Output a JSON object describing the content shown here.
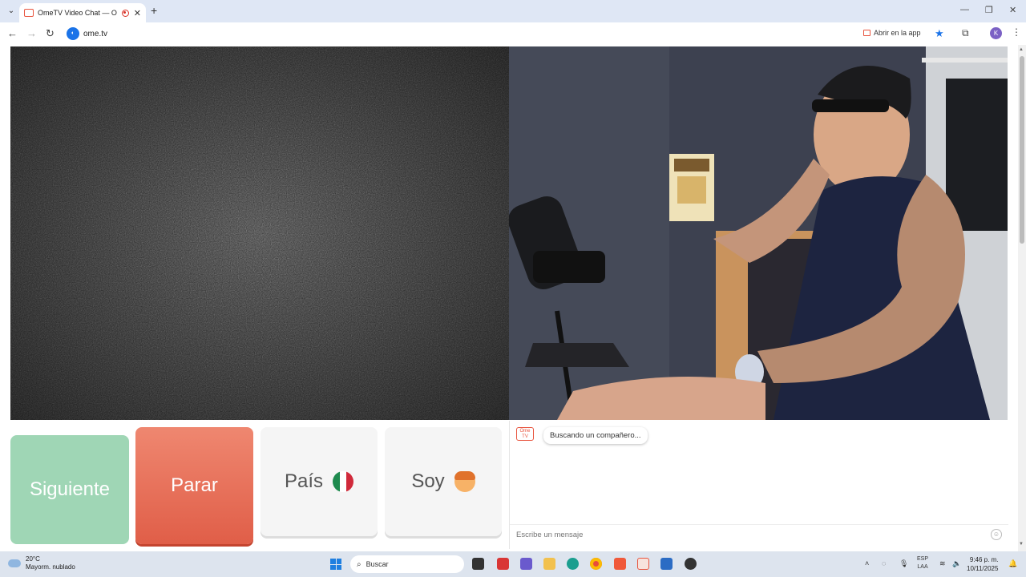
{
  "browser": {
    "tab_title": "OmeTV Video Chat — Omegl",
    "url": "ome.tv",
    "open_app_label": "Abrir en la app",
    "profile_initial": "K"
  },
  "controls": {
    "next_label": "Siguiente",
    "stop_label": "Parar",
    "country_label": "País",
    "gender_label": "Soy"
  },
  "chat": {
    "logo_text": "Ome TV",
    "status_message": "Buscando un compañero...",
    "input_placeholder": "Escribe un mensaje"
  },
  "taskbar": {
    "temperature": "20°C",
    "weather": "Mayorm. nublado",
    "search_label": "Buscar",
    "language": "ESP",
    "language_sub": "LAA",
    "time": "9:46 p. m.",
    "date": "10/11/2025"
  },
  "colors": {
    "next_bg": "#9fd6b5",
    "stop_bg": "#e05e48",
    "accent": "#1a73e8"
  }
}
